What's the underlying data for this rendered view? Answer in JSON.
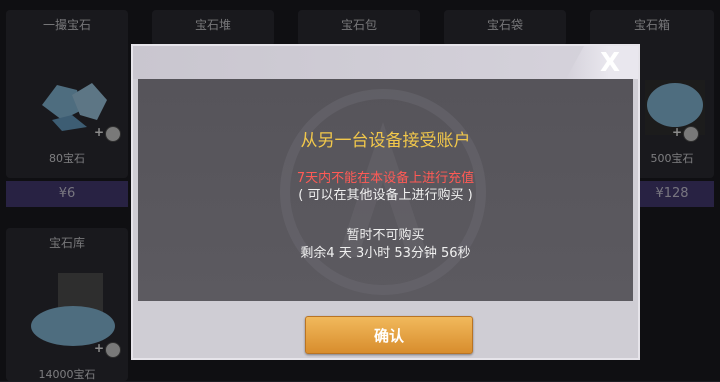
{
  "shop": {
    "cards": [
      {
        "title": "一撮宝石",
        "amount": "80宝石",
        "price": "¥6"
      },
      {
        "title": "宝石堆"
      },
      {
        "title": "宝石包"
      },
      {
        "title": "宝石袋"
      },
      {
        "title": "宝石箱",
        "amount": "500宝石",
        "price": "¥128"
      },
      {
        "title": "宝石库",
        "amount": "14000宝石"
      }
    ],
    "plus_glyph": "+"
  },
  "dialog": {
    "close_glyph": "X",
    "title": "从另一台设备接受账户",
    "warning": "7天内不能在本设备上进行充值",
    "note": "( 可以在其他设备上进行购买 )",
    "status": "暂时不可购买",
    "remaining": "剩余4 天 3小时 53分钟 56秒",
    "confirm_label": "确认"
  },
  "colors": {
    "title_gold": "#f2c84b",
    "warning_red": "#ff5a55",
    "button_orange": "#e8a244",
    "price_bar_purple": "#4a3e7a"
  }
}
